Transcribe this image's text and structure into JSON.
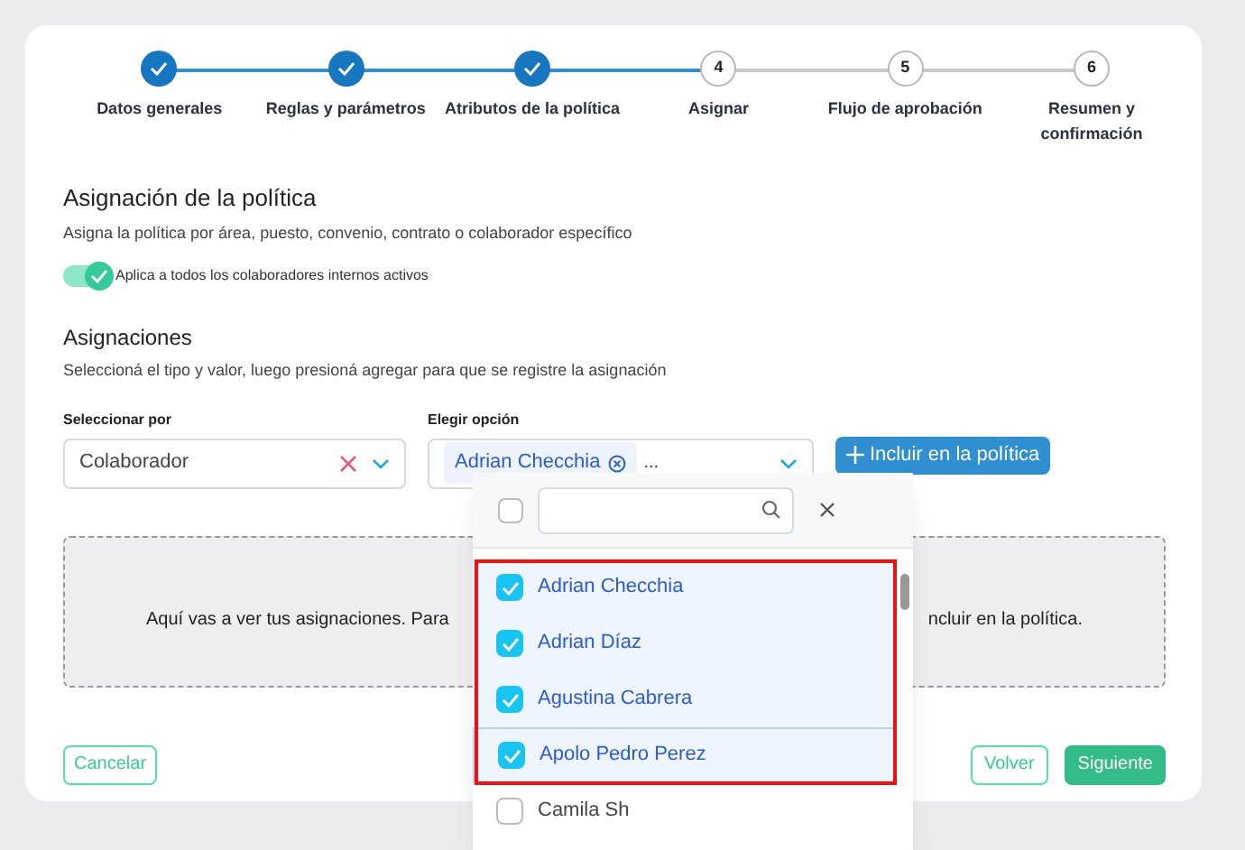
{
  "steps": [
    {
      "label": "Datos generales",
      "completed": true
    },
    {
      "label": "Reglas y parámetros",
      "completed": true
    },
    {
      "label": "Atributos de la política",
      "completed": true
    },
    {
      "number": "4",
      "label": "Asignar",
      "completed": false
    },
    {
      "number": "5",
      "label": "Flujo de aprobación",
      "completed": false
    },
    {
      "number": "6",
      "label": "Resumen y confirmación",
      "completed": false
    }
  ],
  "policy_section": {
    "title": "Asignación de la política",
    "subtitle": "Asigna la política por área, puesto, convenio, contrato o colaborador específico",
    "toggle": {
      "label": "Aplica a todos los colaboradores internos activos",
      "on": true
    }
  },
  "assignments": {
    "title": "Asignaciones",
    "subtitle": "Seleccioná el tipo y valor, luego presioná agregar para que se registre la asignación",
    "select_by": {
      "label": "Seleccionar por",
      "value": "Colaborador"
    },
    "choose_option": {
      "label": "Elegir opción",
      "chips": [
        "Adrian Checchia"
      ],
      "more": "..."
    },
    "include_button": "Incluir en la política",
    "empty_left": "Aquí vas a ver tus asignaciones. Para",
    "empty_right": "ncluir en la política."
  },
  "dropdown": {
    "select_all_checked": false,
    "options": [
      {
        "label": "Adrian Checchia",
        "checked": true,
        "highlighted": false
      },
      {
        "label": "Adrian Díaz",
        "checked": true,
        "highlighted": false
      },
      {
        "label": "Agustina Cabrera",
        "checked": true,
        "highlighted": false
      },
      {
        "label": "Apolo Pedro Perez",
        "checked": true,
        "highlighted": true
      },
      {
        "label": "Camila Sh",
        "checked": false,
        "highlighted": false
      }
    ]
  },
  "footer": {
    "cancel": "Cancelar",
    "back": "Volver",
    "next": "Siguiente"
  }
}
